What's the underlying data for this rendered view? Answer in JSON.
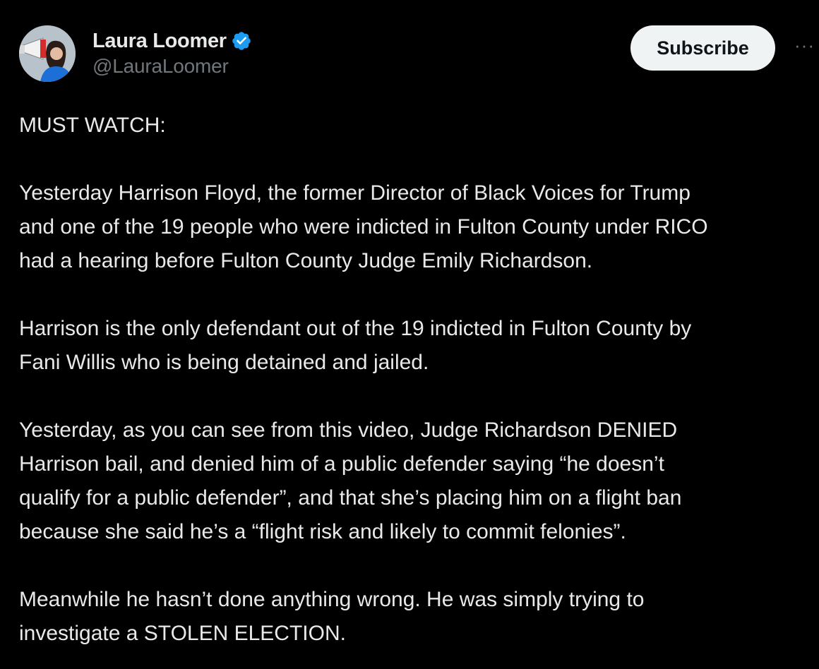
{
  "author": {
    "display_name": "Laura Loomer",
    "handle": "@LauraLoomer",
    "verified_icon": "verified-badge-icon",
    "verified_color": "#1d9bf0"
  },
  "actions": {
    "subscribe_label": "Subscribe",
    "more_label": "···"
  },
  "post": {
    "paragraphs": [
      [
        "MUST WATCH:"
      ],
      [
        "Yesterday Harrison Floyd, the former Director of Black Voices for Trump",
        "and one of the 19 people who were indicted in Fulton County under RICO",
        "had a hearing before Fulton County Judge Emily Richardson."
      ],
      [
        "Harrison is the only defendant out of the 19 indicted in Fulton County by",
        "Fani Willis who is being detained and jailed."
      ],
      [
        "Yesterday, as you can see from this video, Judge Richardson DENIED",
        "Harrison bail, and denied him of a public defender saying “he doesn’t",
        "qualify for a public defender”, and that she’s placing him on a flight ban",
        "because she said he’s a “flight risk and likely to commit felonies”."
      ],
      [
        "Meanwhile he hasn’t done anything wrong. He was simply trying to",
        "investigate a STOLEN ELECTION."
      ]
    ]
  },
  "colors": {
    "background": "#000000",
    "text": "#e7e9ea",
    "secondary_text": "#71767b",
    "button_bg": "#eff3f4"
  }
}
